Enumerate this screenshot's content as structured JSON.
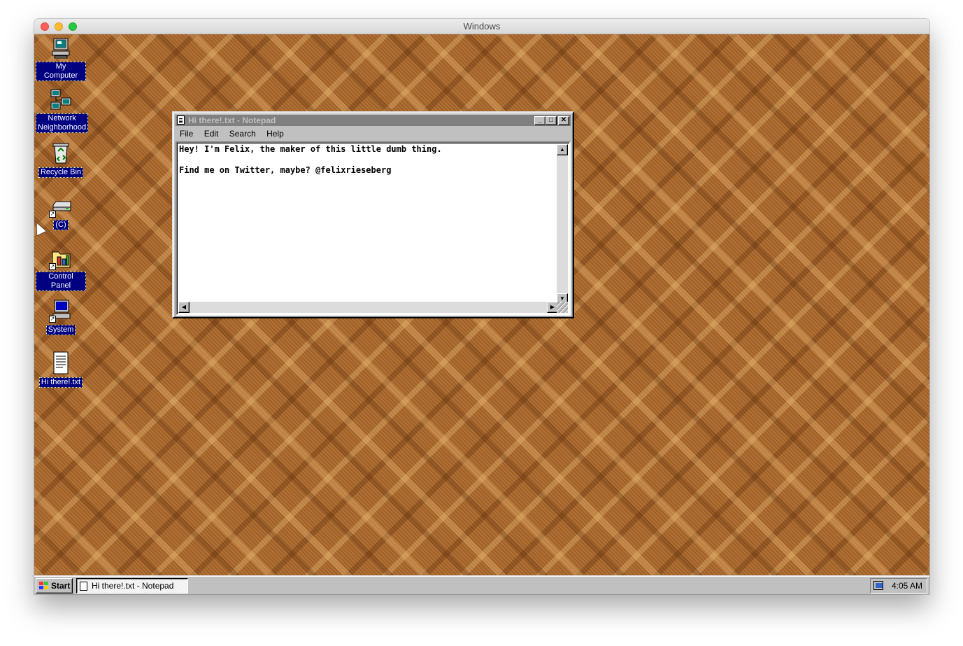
{
  "host_window": {
    "title": "Windows"
  },
  "desktop_icons": [
    {
      "label": "My Computer",
      "icon": "computer-icon"
    },
    {
      "label": "Network\nNeighborhood",
      "label_line1": "Network",
      "label_line2": "Neighborhood",
      "icon": "network-neighborhood-icon"
    },
    {
      "label": "Recycle Bin",
      "icon": "recycle-bin-icon"
    },
    {
      "label": "(C)",
      "icon": "drive-icon"
    },
    {
      "label": "Control Panel",
      "icon": "control-panel-icon"
    },
    {
      "label": "System",
      "icon": "system-icon"
    },
    {
      "label": "Hi there!.txt",
      "icon": "text-file-icon"
    }
  ],
  "notepad": {
    "title": "Hi there!.txt - Notepad",
    "menu": [
      "File",
      "Edit",
      "Search",
      "Help"
    ],
    "content_line1": "Hey! I'm Felix, the maker of this little dumb thing.",
    "content_line2": "",
    "content_line3": "Find me on Twitter, maybe? @felixrieseberg"
  },
  "taskbar": {
    "start_label": "Start",
    "task_label": "Hi there!.txt - Notepad",
    "clock": "4:05 AM"
  },
  "colors": {
    "title_inactive": "#808080",
    "desktop_base": "#a8652a",
    "icon_label_bg": "#000080"
  }
}
